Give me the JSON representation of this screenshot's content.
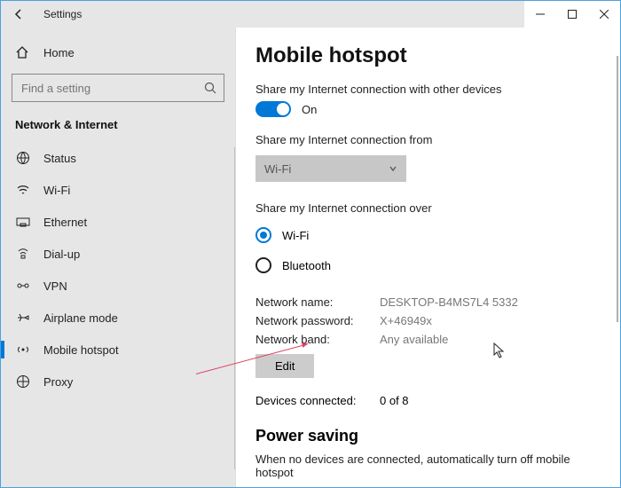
{
  "window": {
    "title": "Settings"
  },
  "sidebar": {
    "home_label": "Home",
    "search_placeholder": "Find a setting",
    "section": "Network & Internet",
    "items": [
      {
        "label": "Status",
        "icon": "globe-icon"
      },
      {
        "label": "Wi-Fi",
        "icon": "wifi-icon"
      },
      {
        "label": "Ethernet",
        "icon": "ethernet-icon"
      },
      {
        "label": "Dial-up",
        "icon": "dialup-icon"
      },
      {
        "label": "VPN",
        "icon": "vpn-icon"
      },
      {
        "label": "Airplane mode",
        "icon": "airplane-icon"
      },
      {
        "label": "Mobile hotspot",
        "icon": "hotspot-icon",
        "selected": true
      },
      {
        "label": "Proxy",
        "icon": "proxy-icon"
      }
    ]
  },
  "main": {
    "heading": "Mobile hotspot",
    "share_label": "Share my Internet connection with other devices",
    "toggle_state": "On",
    "share_from_label": "Share my Internet connection from",
    "share_from_value": "Wi-Fi",
    "share_over_label": "Share my Internet connection over",
    "radio_wifi": "Wi-Fi",
    "radio_bt": "Bluetooth",
    "net_name_k": "Network name:",
    "net_name_v": "DESKTOP-B4MS7L4 5332",
    "net_pass_k": "Network password:",
    "net_pass_v": "X+46949x",
    "net_band_k": "Network band:",
    "net_band_v": "Any available",
    "edit_label": "Edit",
    "devices_k": "Devices connected:",
    "devices_v": "0 of 8",
    "pwr_heading": "Power saving",
    "pwr_text": "When no devices are connected, automatically turn off mobile hotspot"
  }
}
